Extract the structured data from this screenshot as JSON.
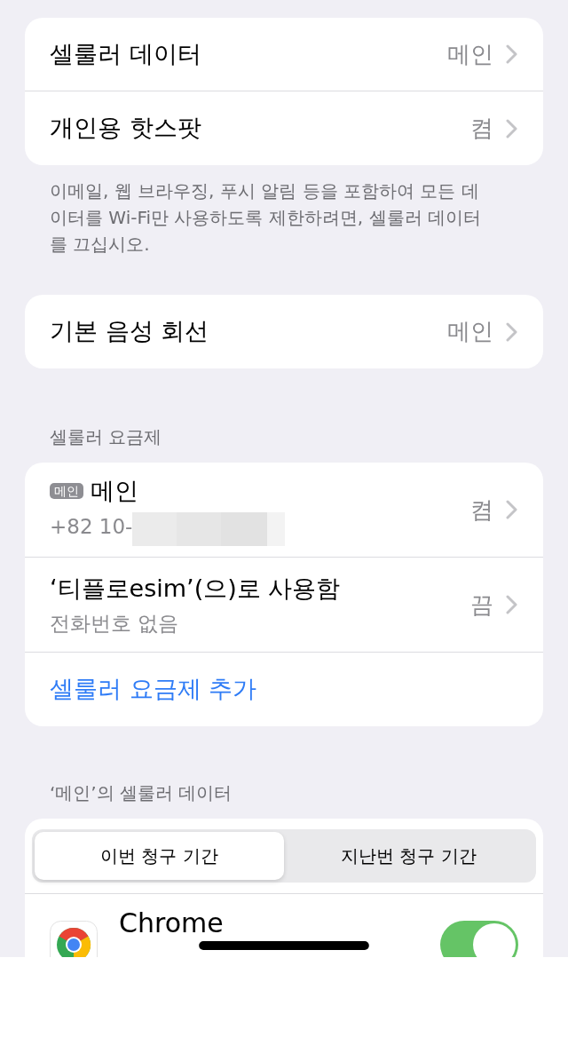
{
  "cellular": [
    {
      "label": "셀룰러 데이터",
      "value": "메인"
    },
    {
      "label": "개인용 핫스팟",
      "value": "켬"
    }
  ],
  "cellular_footer": "이메일, 웹 브라우징, 푸시 알림 등을 포함하여 모든 데이터를 Wi-Fi만 사용하도록 제한하려면, 셀룰러 데이터를 끄십시오.",
  "voice": [
    {
      "label": "기본 음성 회선",
      "value": "메인"
    }
  ],
  "plans_header": "셀룰러 요금제",
  "plans": [
    {
      "badge": "메인",
      "name": "메인",
      "subtitle": "+82 10-",
      "redacted": true,
      "status": "켬"
    },
    {
      "name": "‘티플로esim’(으)로 사용함",
      "subtitle": "전화번호 없음",
      "redacted": false,
      "status": "끔"
    }
  ],
  "add_plan": "셀룰러 요금제 추가",
  "usage_header": "‘메인’의 셀룰러 데이터",
  "periods": [
    {
      "label": "이번 청구 기간",
      "selected": true
    },
    {
      "label": "지난번 청구 기간",
      "selected": false
    }
  ],
  "apps": [
    {
      "name": "Chrome",
      "on": true
    }
  ]
}
